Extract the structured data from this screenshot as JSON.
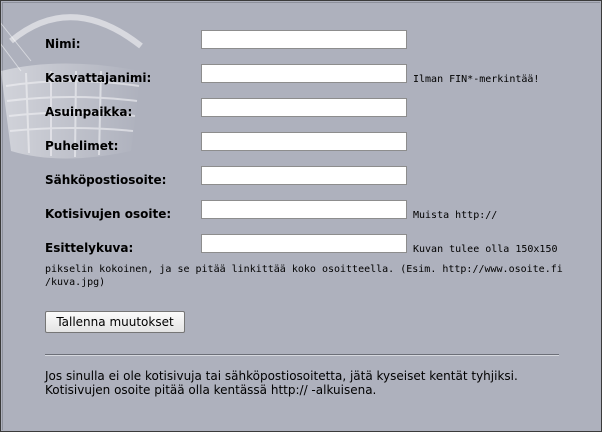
{
  "form": {
    "fields": [
      {
        "label": "Nimi:",
        "value": "",
        "hint": ""
      },
      {
        "label": "Kasvattajanimi:",
        "value": "",
        "hint": "Ilman FIN*-merkintää!"
      },
      {
        "label": "Asuinpaikka:",
        "value": "",
        "hint": ""
      },
      {
        "label": "Puhelimet:",
        "value": "",
        "hint": ""
      },
      {
        "label": "Sähköpostiosoite:",
        "value": "",
        "hint": ""
      },
      {
        "label": "Kotisivujen osoite:",
        "value": "",
        "hint": "Muista http://"
      },
      {
        "label": "Esittelykuva:",
        "value": "",
        "hint": "Kuvan tulee olla 150x150"
      }
    ],
    "image_hint_continued_line1": "pikselin kokoinen, ja se pitää linkittää koko osoitteella. (Esim. http://www.osoite.fi",
    "image_hint_continued_line2": "/kuva.jpg)",
    "save_label": "Tallenna muutokset"
  },
  "footer": {
    "note_line1": "Jos sinulla ei ole kotisivuja tai sähköpostiosoitetta, jätä kyseiset kentät tyhjiksi.",
    "note_line2": "Kotisivujen osoite pitää olla kentässä http:// -alkuisena."
  },
  "decor": {
    "background_image": "wicker-basket-icon"
  }
}
